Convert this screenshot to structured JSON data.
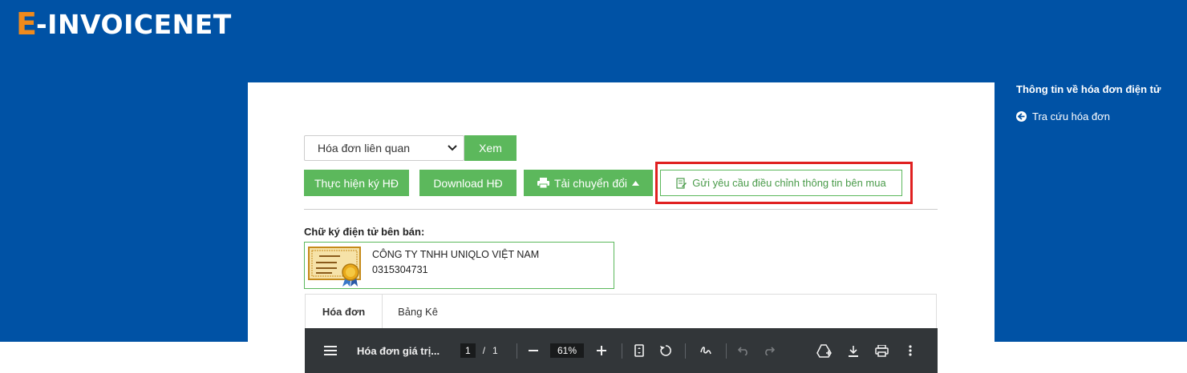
{
  "brand": {
    "logo_e": "E",
    "logo_rest": "-INVOICENET",
    "accent": "#f08a1c",
    "header_bg": "#0052a5"
  },
  "toolbar": {
    "select_value": "Hóa đơn liên quan",
    "xem_label": "Xem",
    "ky_label": "Thực hiện ký HĐ",
    "download_label": "Download HĐ",
    "convert_label": "Tải chuyển đổi",
    "request_label": "Gửi yêu cầu điều chỉnh thông tin bên mua",
    "green": "#5cb85c",
    "highlight": "#e02020"
  },
  "signature": {
    "title": "Chữ ký điện tử bên bán:",
    "company": "CÔNG TY TNHH UNIQLO VIỆT NAM",
    "tax_code": "0315304731"
  },
  "tabs": [
    {
      "label": "Hóa đơn",
      "active": true
    },
    {
      "label": "Bảng Kê",
      "active": false
    }
  ],
  "viewer": {
    "title": "Hóa đơn giá trị...",
    "page_current": "1",
    "page_sep": "/",
    "page_total": "1",
    "zoom": "61%"
  },
  "sidebar": {
    "title": "Thông tin về hóa đơn điện tử",
    "link": "Tra cứu hóa đơn"
  }
}
